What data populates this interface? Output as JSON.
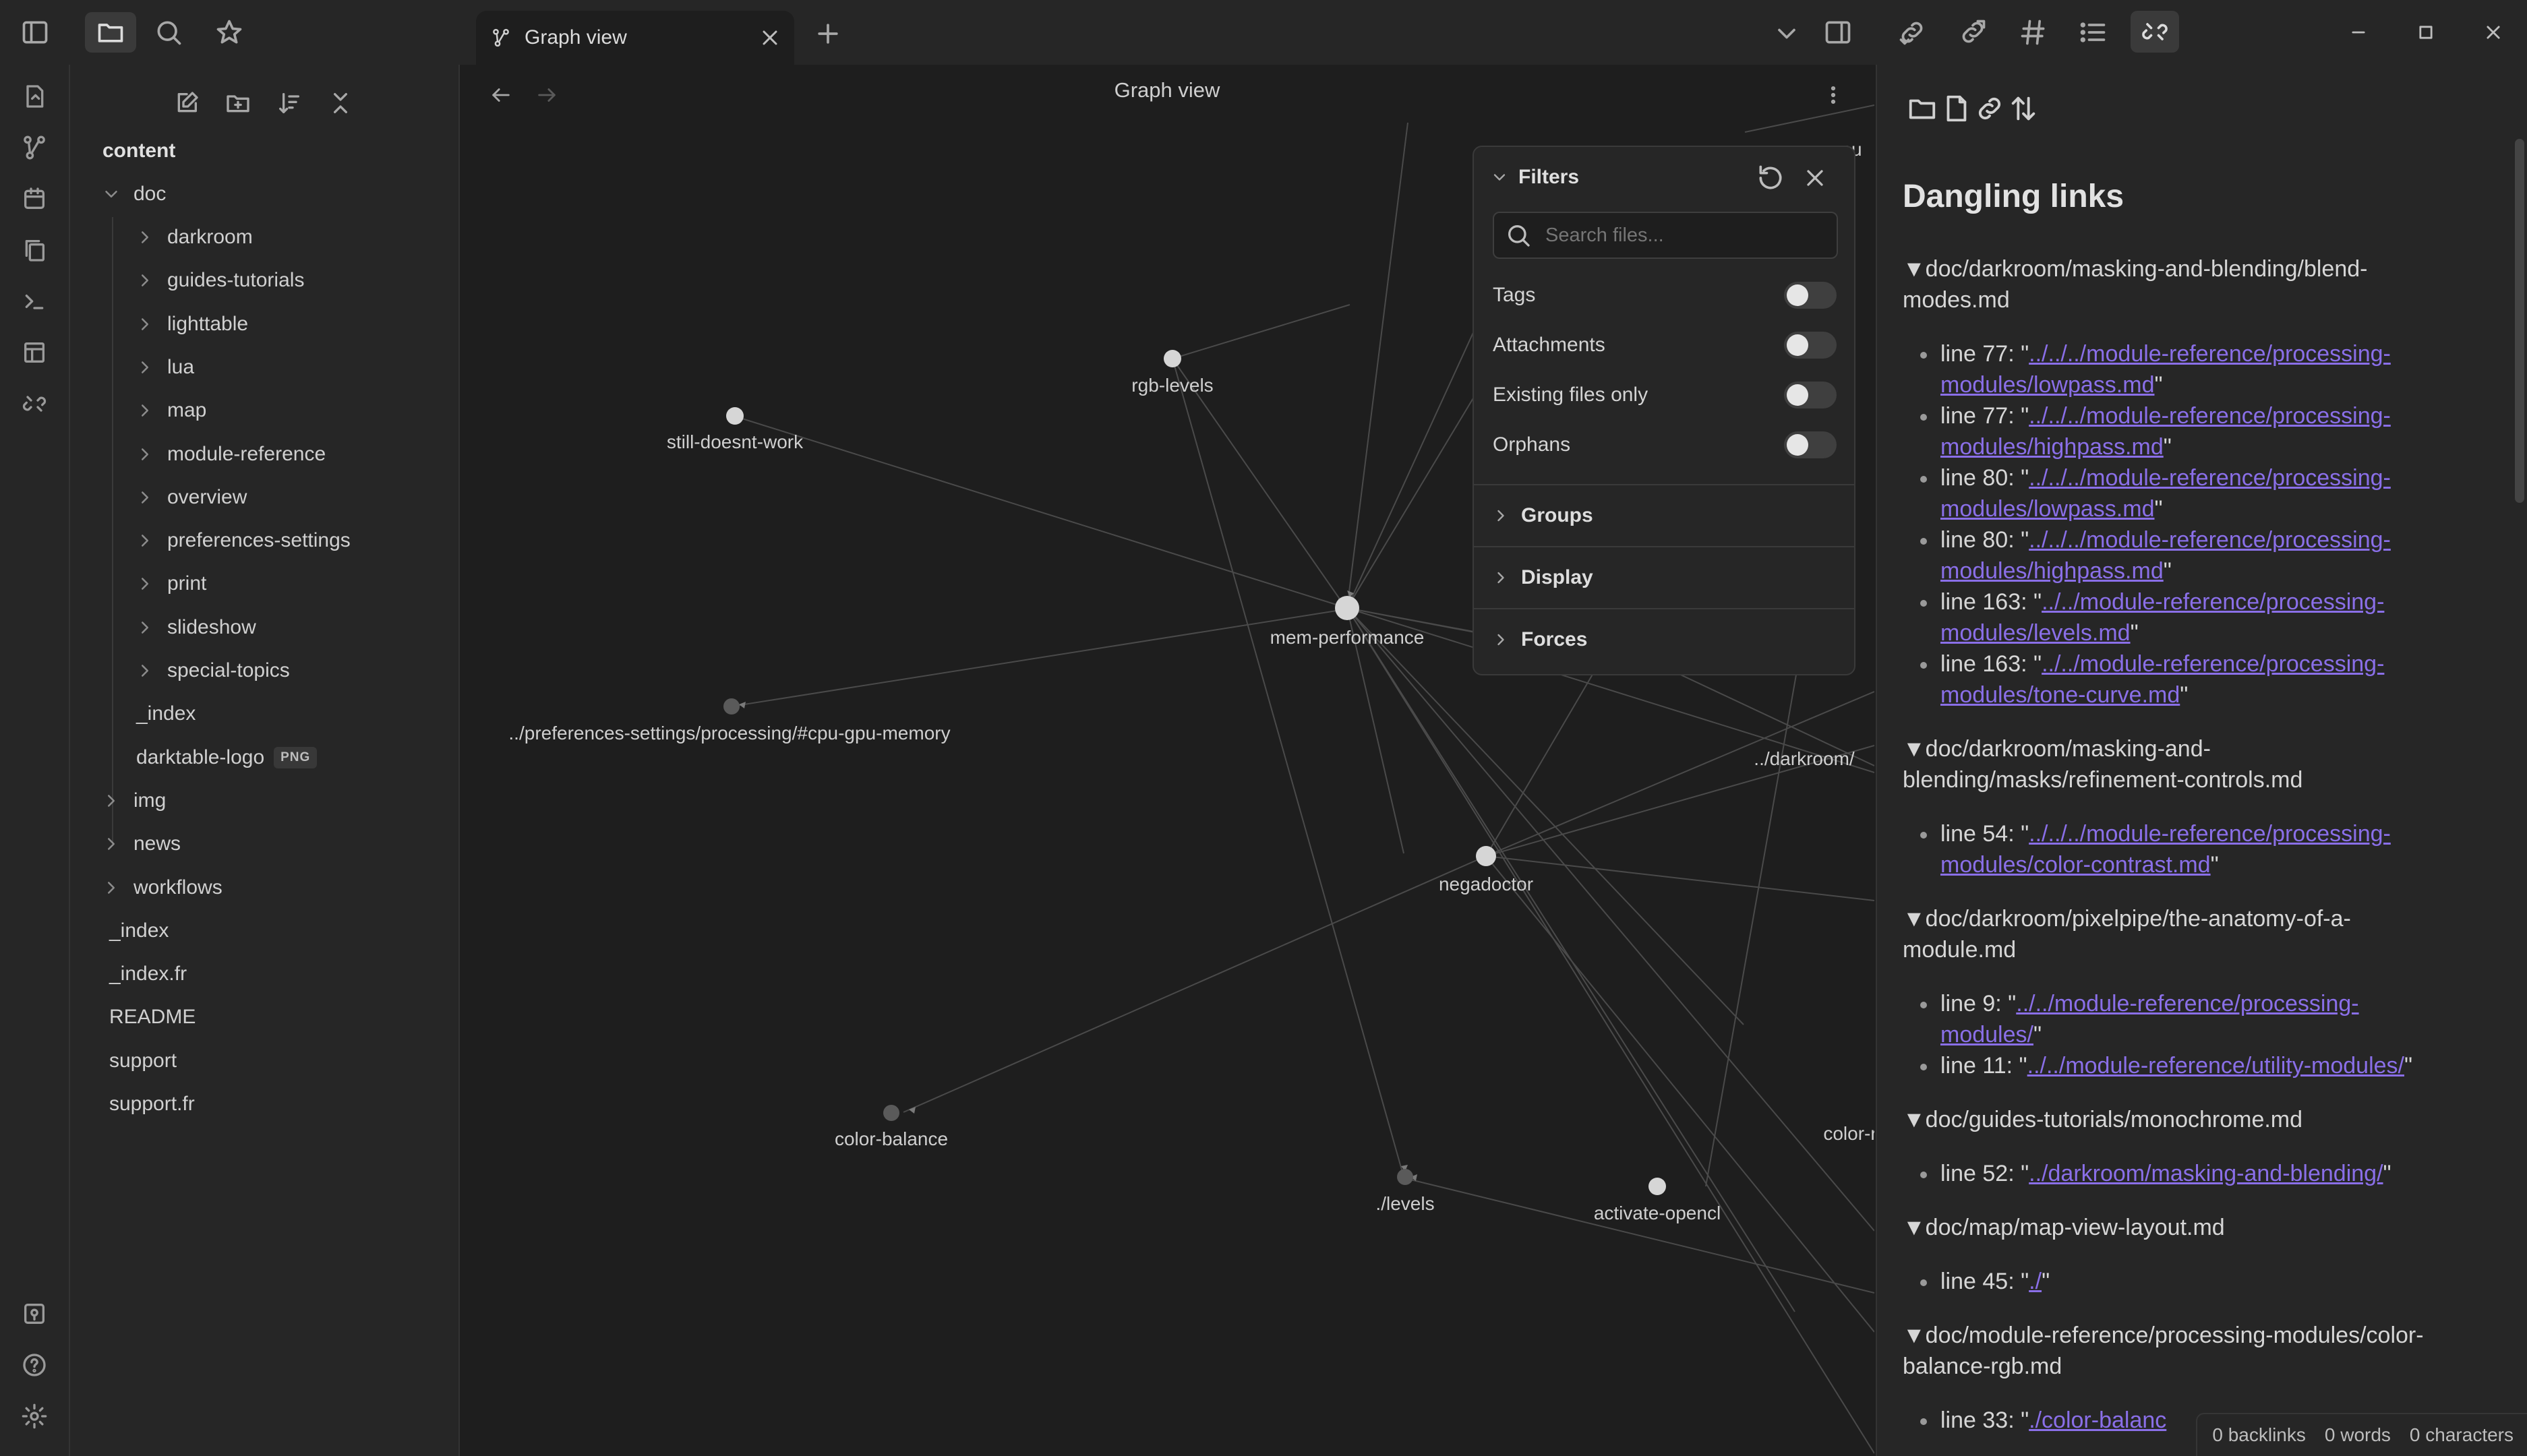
{
  "tab": {
    "title": "Graph view",
    "new_tab": "+"
  },
  "graph": {
    "title": "Graph view",
    "nodes": [
      {
        "id": "rgb-levels",
        "label": "rgb-levels"
      },
      {
        "id": "still-doesnt-work",
        "label": "still-doesnt-work"
      },
      {
        "id": "mem-performance",
        "label": "mem-performance"
      },
      {
        "id": "cpu-gpu",
        "label": "../preferences-settings/processing/#cpu-gpu-memory"
      },
      {
        "id": "negadoctor",
        "label": "negadoctor"
      },
      {
        "id": "color-balance",
        "label": "color-balance"
      },
      {
        "id": "levels",
        "label": "./levels"
      },
      {
        "id": "activate-opencl",
        "label": "activate-opencl"
      },
      {
        "id": "darkroom",
        "label": "../darkroom/"
      },
      {
        "id": "color-r",
        "label": "color-r"
      },
      {
        "id": "top-pu",
        "label": "pu"
      }
    ]
  },
  "filters": {
    "title": "Filters",
    "search_placeholder": "Search files...",
    "toggles": [
      {
        "label": "Tags",
        "on": false
      },
      {
        "label": "Attachments",
        "on": false
      },
      {
        "label": "Existing files only",
        "on": false
      },
      {
        "label": "Orphans",
        "on": false
      }
    ],
    "sections": [
      "Groups",
      "Display",
      "Forces"
    ]
  },
  "explorer": {
    "root": "content",
    "doc": "doc",
    "doc_children": [
      "darkroom",
      "guides-tutorials",
      "lighttable",
      "lua",
      "map",
      "module-reference",
      "overview",
      "preferences-settings",
      "print",
      "slideshow",
      "special-topics"
    ],
    "doc_files": [
      {
        "name": "_index",
        "badge": ""
      },
      {
        "name": "darktable-logo",
        "badge": "PNG"
      }
    ],
    "folders": [
      "img",
      "news",
      "workflows"
    ],
    "files": [
      "_index",
      "_index.fr",
      "README",
      "support",
      "support.fr"
    ]
  },
  "dangling": {
    "title": "Dangling links",
    "groups": [
      {
        "file": "doc/darkroom/masking-and-blending/blend-modes.md",
        "file_lines": [
          "doc/darkroom/masking-and-blending/blend-",
          "modes.md"
        ],
        "lines": [
          {
            "prefix": "line 77: \"",
            "link": [
              "../../../module-reference/processing-",
              "modules/lowpass.md"
            ],
            "suffix": "\""
          },
          {
            "prefix": "line 77: \"",
            "link": [
              "../../../module-reference/processing-",
              "modules/highpass.md"
            ],
            "suffix": "\""
          },
          {
            "prefix": "line 80: \"",
            "link": [
              "../../../module-reference/processing-",
              "modules/lowpass.md"
            ],
            "suffix": "\""
          },
          {
            "prefix": "line 80: \"",
            "link": [
              "../../../module-reference/processing-",
              "modules/highpass.md"
            ],
            "suffix": "\""
          },
          {
            "prefix": "line 163: \"",
            "link": [
              "../../module-reference/processing-",
              "modules/levels.md"
            ],
            "suffix": "\""
          },
          {
            "prefix": "line 163: \"",
            "link": [
              "../../module-reference/processing-",
              "modules/tone-curve.md"
            ],
            "suffix": "\""
          }
        ]
      },
      {
        "file": "doc/darkroom/masking-and-blending/masks/refinement-controls.md",
        "file_lines": [
          "doc/darkroom/masking-and-",
          "blending/masks/refinement-controls.md"
        ],
        "lines": [
          {
            "prefix": "line 54: \"",
            "link": [
              "../../../module-reference/processing-",
              "modules/color-contrast.md"
            ],
            "suffix": "\""
          }
        ]
      },
      {
        "file": "doc/darkroom/pixelpipe/the-anatomy-of-a-module.md",
        "file_lines": [
          "doc/darkroom/pixelpipe/the-anatomy-of-a-",
          "module.md"
        ],
        "lines": [
          {
            "prefix": "line 9: \"",
            "link": [
              "../../module-reference/processing-",
              "modules/"
            ],
            "suffix": "\""
          },
          {
            "prefix": "line 11: \"",
            "link": [
              "../../module-reference/utility-modules/"
            ],
            "suffix": "\""
          }
        ]
      },
      {
        "file": "doc/guides-tutorials/monochrome.md",
        "file_lines": [
          "doc/guides-tutorials/monochrome.md"
        ],
        "lines": [
          {
            "prefix": "line 52: \"",
            "link": [
              "../darkroom/masking-and-blending/"
            ],
            "suffix": "\""
          }
        ]
      },
      {
        "file": "doc/map/map-view-layout.md",
        "file_lines": [
          "doc/map/map-view-layout.md"
        ],
        "lines": [
          {
            "prefix": "line 45: \"",
            "link": [
              "./"
            ],
            "suffix": "\""
          }
        ]
      },
      {
        "file": "doc/module-reference/processing-modules/color-balance-rgb.md",
        "file_lines": [
          "doc/module-reference/processing-modules/color-",
          "balance-rgb.md"
        ],
        "lines": [
          {
            "prefix": "line 33: \"",
            "link": [
              "./color-balanc"
            ],
            "suffix": ""
          }
        ]
      }
    ]
  },
  "status": {
    "backlinks": "0 backlinks",
    "words": "0 words",
    "characters": "0 characters"
  },
  "colors": {
    "accent": "#8a6fe8",
    "bg": "#1e1e1e",
    "panel": "#262626"
  }
}
